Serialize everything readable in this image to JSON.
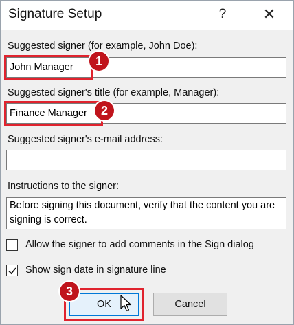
{
  "dialog": {
    "title": "Signature Setup",
    "help_glyph": "?",
    "close_glyph": "✕"
  },
  "fields": {
    "signer_label": "Suggested signer (for example, John Doe):",
    "signer_value": "John Manager",
    "title_label": "Suggested signer's title (for example, Manager):",
    "title_value": "Finance Manager",
    "email_label": "Suggested signer's e-mail address:",
    "email_value": "",
    "instructions_label": "Instructions to the signer:",
    "instructions_value": "Before signing this document, verify that the content you are signing is correct."
  },
  "options": {
    "allow_comments_label": "Allow the signer to add comments in the Sign dialog",
    "allow_comments_checked": false,
    "show_date_label": "Show sign date in signature line",
    "show_date_checked": true
  },
  "buttons": {
    "ok_label": "OK",
    "cancel_label": "Cancel"
  },
  "annotations": {
    "step1": "1",
    "step2": "2",
    "step3": "3",
    "highlight_color": "#e0232e",
    "badge_color": "#c0141c"
  }
}
